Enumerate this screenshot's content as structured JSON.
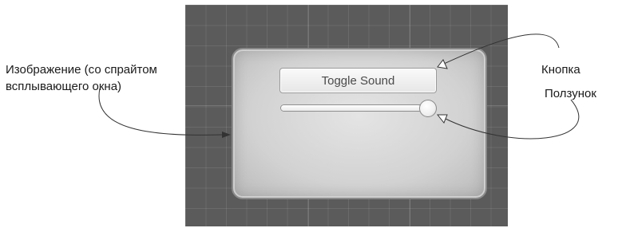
{
  "popup": {
    "button_label": "Toggle Sound",
    "slider_value": 0.93
  },
  "annotations": {
    "image_label_line1": "Изображение (со спрайтом",
    "image_label_line2": "всплывающего окна)",
    "button_label": "Кнопка",
    "slider_label": "Ползунок"
  },
  "colors": {
    "scene_background": "#5b5b5b",
    "popup_fill": "#d8d8d8",
    "popup_border": "#8a8a8a",
    "annotation_line": "#333333"
  }
}
